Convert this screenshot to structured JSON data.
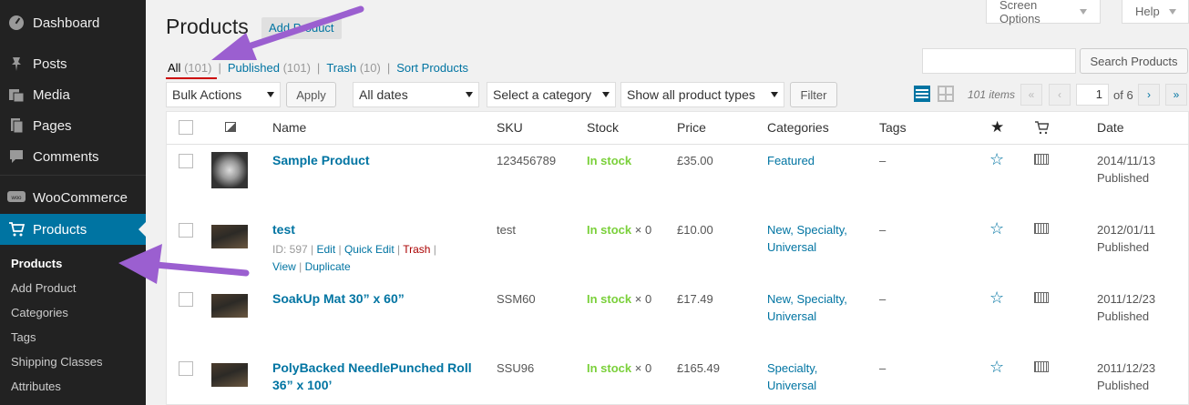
{
  "sidebar": {
    "menu": [
      {
        "label": "Dashboard",
        "icon": "dashboard-icon"
      },
      {
        "label": "Posts",
        "icon": "pin-icon"
      },
      {
        "label": "Media",
        "icon": "media-icon"
      },
      {
        "label": "Pages",
        "icon": "pages-icon"
      },
      {
        "label": "Comments",
        "icon": "comment-icon"
      },
      {
        "label": "WooCommerce",
        "icon": "woo-icon"
      },
      {
        "label": "Products",
        "icon": "cart-icon"
      }
    ],
    "submenu": [
      "Products",
      "Add Product",
      "Categories",
      "Tags",
      "Shipping Classes",
      "Attributes"
    ]
  },
  "header": {
    "title": "Products",
    "add_button": "Add Product",
    "screen_options": "Screen Options",
    "help": "Help"
  },
  "filters": {
    "all": "All",
    "all_count": "(101)",
    "published": "Published",
    "published_count": "(101)",
    "trash": "Trash",
    "trash_count": "(10)",
    "sort": "Sort Products"
  },
  "search": {
    "button": "Search Products",
    "value": ""
  },
  "toolbar": {
    "bulk_actions": "Bulk Actions",
    "apply": "Apply",
    "dates": "All dates",
    "category": "Select a category",
    "product_type": "Show all product types",
    "filter": "Filter"
  },
  "pagination": {
    "items": "101 items",
    "first": "«",
    "prev": "‹",
    "next": "›",
    "last": "»",
    "current": "1",
    "of": "of 6"
  },
  "columns": {
    "name": "Name",
    "sku": "SKU",
    "stock": "Stock",
    "price": "Price",
    "categories": "Categories",
    "tags": "Tags",
    "date": "Date"
  },
  "rows": [
    {
      "name": "Sample Product",
      "sku": "123456789",
      "stock": "In stock",
      "stock_qty": "",
      "price": "£35.00",
      "categories": "Featured",
      "tags": "–",
      "date": "2014/11/13",
      "status": "Published"
    },
    {
      "name": "test",
      "sku": "test",
      "stock": "In stock",
      "stock_qty": " × 0",
      "price": "£10.00",
      "categories": "New, Specialty,",
      "categories2": "Universal",
      "tags": "–",
      "date": "2012/01/11",
      "status": "Published",
      "actions": {
        "id": "ID: 597 |",
        "edit": "Edit",
        "quick_edit": "Quick Edit",
        "trash": "Trash",
        "view": "View",
        "duplicate": "Duplicate"
      }
    },
    {
      "name": "SoakUp Mat 30” x 60”",
      "sku": "SSM60",
      "stock": "In stock",
      "stock_qty": " × 0",
      "price": "£17.49",
      "categories": "New, Specialty,",
      "categories2": "Universal",
      "tags": "–",
      "date": "2011/12/23",
      "status": "Published"
    },
    {
      "name": "PolyBacked NeedlePunched Roll",
      "name2": "36” x 100’",
      "sku": "SSU96",
      "stock": "In stock",
      "stock_qty": " × 0",
      "price": "£165.49",
      "categories": "Specialty,",
      "categories2": "Universal",
      "tags": "–",
      "date": "2011/12/23",
      "status": "Published"
    }
  ],
  "colors": {
    "accent": "#0074a2",
    "sidebar": "#222222",
    "instock": "#7ad03a",
    "annotation": "#9b5fd0"
  }
}
